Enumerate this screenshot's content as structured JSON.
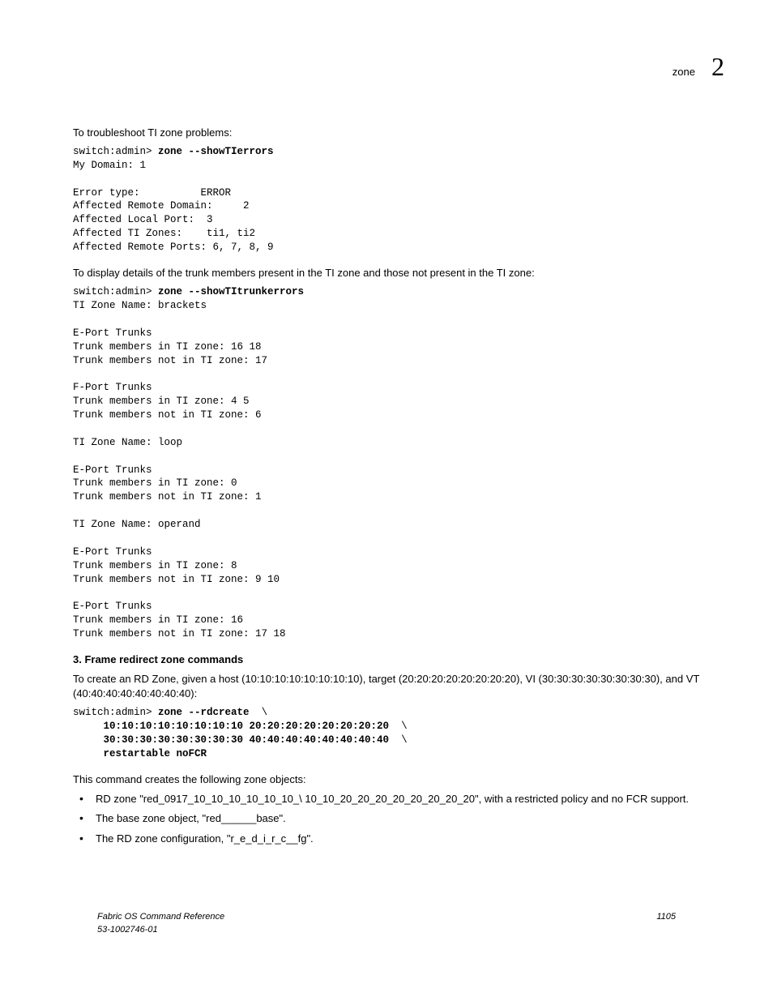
{
  "header": {
    "word": "zone",
    "chapter": "2"
  },
  "para1": "To troubleshoot TI zone problems:",
  "code1_prompt": "switch:admin> ",
  "code1_cmd": "zone --showTIerrors",
  "code1_body": "My Domain: 1\n\nError type:          ERROR\nAffected Remote Domain:     2\nAffected Local Port:  3\nAffected TI Zones:    ti1, ti2\nAffected Remote Ports: 6, 7, 8, 9",
  "para2": "To display details of the trunk members present in the TI zone and those not present in the TI zone:",
  "code2_prompt": "switch:admin> ",
  "code2_cmd": "zone --showTItrunkerrors",
  "code2_body": "TI Zone Name: brackets\n\nE-Port Trunks\nTrunk members in TI zone: 16 18\nTrunk members not in TI zone: 17\n\nF-Port Trunks\nTrunk members in TI zone: 4 5\nTrunk members not in TI zone: 6\n\nTI Zone Name: loop\n\nE-Port Trunks\nTrunk members in TI zone: 0\nTrunk members not in TI zone: 1\n\nTI Zone Name: operand\n\nE-Port Trunks\nTrunk members in TI zone: 8\nTrunk members not in TI zone: 9 10\n\nE-Port Trunks\nTrunk members in TI zone: 16\nTrunk members not in TI zone: 17 18",
  "section3_head": "3. Frame redirect zone commands",
  "para3": "To create an RD Zone, given a host (10:10:10:10:10:10:10:10), target (20:20:20:20:20:20:20:20), VI (30:30:30:30:30:30:30:30), and VT (40:40:40:40:40:40:40:40):",
  "code3_prompt": "switch:admin> ",
  "code3_cmd_l1": "zone --rdcreate ",
  "code3_cmd_l2": "     10:10:10:10:10:10:10:10 20:20:20:20:20:20:20:20 ",
  "code3_cmd_l3": "     30:30:30:30:30:30:30:30 40:40:40:40:40:40:40:40 ",
  "code3_cmd_l4": "     restartable noFCR",
  "para4": "This command creates the following zone objects:",
  "bullets": [
    "RD zone \"red_0917_10_10_10_10_10_10_\\ 10_10_20_20_20_20_20_20_20_20\", with a restricted policy and no FCR support.",
    "The base zone object, \"red______base\".",
    "The RD zone configuration, \"r_e_d_i_r_c__fg\"."
  ],
  "footer": {
    "left_line1": "Fabric OS Command Reference",
    "left_line2": "53-1002746-01",
    "page": "1105"
  }
}
